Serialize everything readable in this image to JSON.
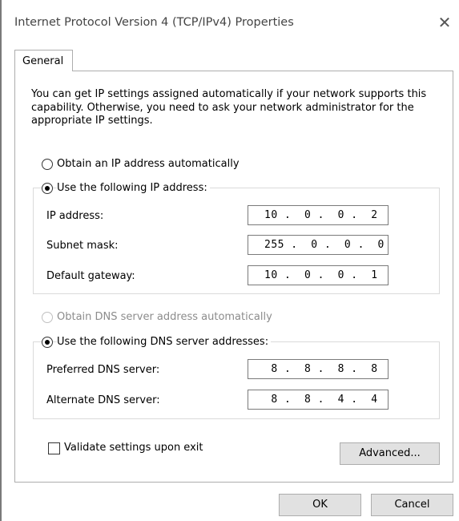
{
  "window": {
    "title": "Internet Protocol Version 4 (TCP/IPv4) Properties",
    "close_glyph": "✕"
  },
  "tabs": [
    "General"
  ],
  "intro": "You can get IP settings assigned automatically if your network supports this capability. Otherwise, you need to ask your network administrator for the appropriate IP settings.",
  "ip": {
    "auto_label": "Obtain an IP address automatically",
    "manual_label": "Use the following IP address:",
    "selected": "manual",
    "fields": [
      {
        "label": "IP address:",
        "value": "10 .  0 .  0 .  2"
      },
      {
        "label": "Subnet mask:",
        "value": "255 .  0 .  0 .  0"
      },
      {
        "label": "Default gateway:",
        "value": "10 .  0 .  0 .  1"
      }
    ]
  },
  "dns": {
    "auto_label": "Obtain DNS server address automatically",
    "manual_label": "Use the following DNS server addresses:",
    "selected": "manual",
    "fields": [
      {
        "label": "Preferred DNS server:",
        "value": " 8 .  8 .  8 .  8"
      },
      {
        "label": "Alternate DNS server:",
        "value": " 8 .  8 .  4 .  4"
      }
    ]
  },
  "validate": {
    "label": "Validate settings upon exit",
    "checked": false
  },
  "buttons": {
    "advanced": "Advanced...",
    "ok": "OK",
    "cancel": "Cancel"
  }
}
